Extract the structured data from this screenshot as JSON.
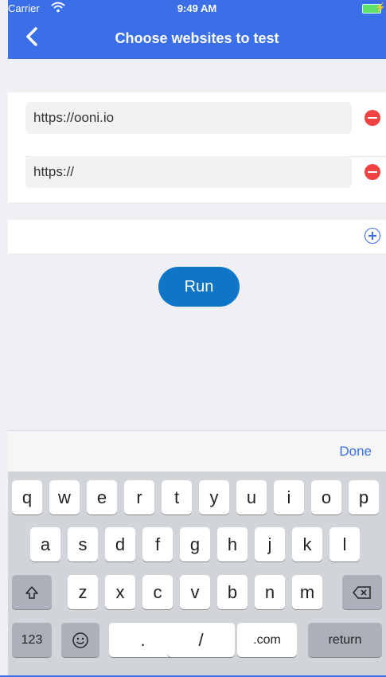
{
  "status_bar": {
    "carrier": "Carrier",
    "time": "9:49 AM"
  },
  "nav": {
    "title": "Choose websites to test"
  },
  "urls": [
    {
      "value": "https://ooni.io"
    },
    {
      "value": "https://"
    }
  ],
  "run_button": {
    "label": "Run"
  },
  "accessory": {
    "done_label": "Done"
  },
  "keyboard": {
    "row1": [
      "q",
      "w",
      "e",
      "r",
      "t",
      "y",
      "u",
      "i",
      "o",
      "p"
    ],
    "row2": [
      "a",
      "s",
      "d",
      "f",
      "g",
      "h",
      "j",
      "k",
      "l"
    ],
    "row3": [
      "z",
      "x",
      "c",
      "v",
      "b",
      "n",
      "m"
    ],
    "numbers_key": "123",
    "dot_key": ".",
    "slash_key": "/",
    "dotcom_key": ".com",
    "return_key": "return"
  },
  "colors": {
    "brand_blue": "#3a6fe8",
    "run_blue": "#0e75c7",
    "remove_red": "#ee4342"
  }
}
